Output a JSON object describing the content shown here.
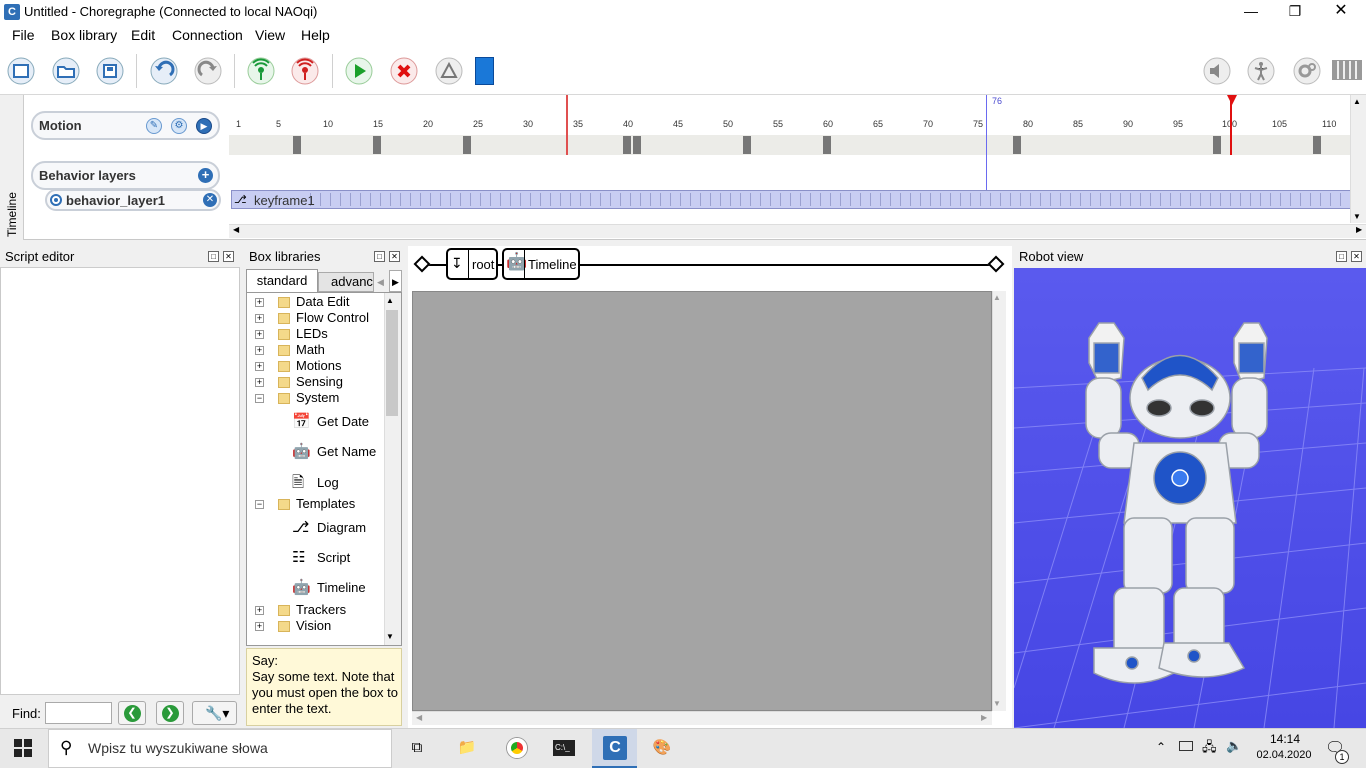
{
  "window": {
    "title": "Untitled - Choregraphe (Connected to local NAOqi)",
    "app_letter": "C"
  },
  "menu": [
    "File",
    "Box library",
    "Edit",
    "Connection",
    "View",
    "Help"
  ],
  "colors": {
    "accent": "#2f6fb6",
    "playhead": "#e02020",
    "cursor": "#6a6af0",
    "floor": "#4a4ae8"
  },
  "timeline": {
    "side_label": "Timeline",
    "motion_label": "Motion",
    "behavior_layers_label": "Behavior layers",
    "layer_name": "behavior_layer1",
    "keyframe_label": "keyframe1",
    "cursor_frame": "76",
    "ruler": [
      "1",
      "5",
      "10",
      "15",
      "20",
      "25",
      "30",
      "35",
      "40",
      "45",
      "50",
      "55",
      "60",
      "65",
      "70",
      "75",
      "80",
      "85",
      "90",
      "95",
      "100",
      "105",
      "110"
    ]
  },
  "script_editor": {
    "title": "Script editor",
    "find_label": "Find:",
    "find_value": ""
  },
  "box_libraries": {
    "title": "Box libraries",
    "tabs": [
      "standard",
      "advance"
    ],
    "items": [
      {
        "label": "Data Edit",
        "type": "folder"
      },
      {
        "label": "Flow Control",
        "type": "folder"
      },
      {
        "label": "LEDs",
        "type": "folder"
      },
      {
        "label": "Math",
        "type": "folder"
      },
      {
        "label": "Motions",
        "type": "folder"
      },
      {
        "label": "Sensing",
        "type": "folder"
      },
      {
        "label": "System",
        "type": "folder-open"
      },
      {
        "label": "Get Date",
        "type": "box",
        "icon": "calendar-icon",
        "glyph": "31"
      },
      {
        "label": "Get Name",
        "type": "box",
        "icon": "robot-icon"
      },
      {
        "label": "Log",
        "type": "box",
        "icon": "log-icon"
      },
      {
        "label": "Templates",
        "type": "folder-open"
      },
      {
        "label": "Diagram",
        "type": "box",
        "icon": "diagram-icon"
      },
      {
        "label": "Script",
        "type": "box",
        "icon": "script-icon"
      },
      {
        "label": "Timeline",
        "type": "box",
        "icon": "timeline-icon"
      },
      {
        "label": "Trackers",
        "type": "folder"
      },
      {
        "label": "Vision",
        "type": "folder"
      }
    ],
    "description_title": "Say:",
    "description": "Say some text. Note that you must open the box to enter the text."
  },
  "flow": {
    "root_label": "root",
    "timeline_label": "Timeline"
  },
  "robot_view": {
    "title": "Robot view"
  },
  "taskbar": {
    "search_placeholder": "Wpisz tu wyszukiwane słowa",
    "time": "14:14",
    "date": "02.04.2020",
    "notification_count": "1"
  }
}
